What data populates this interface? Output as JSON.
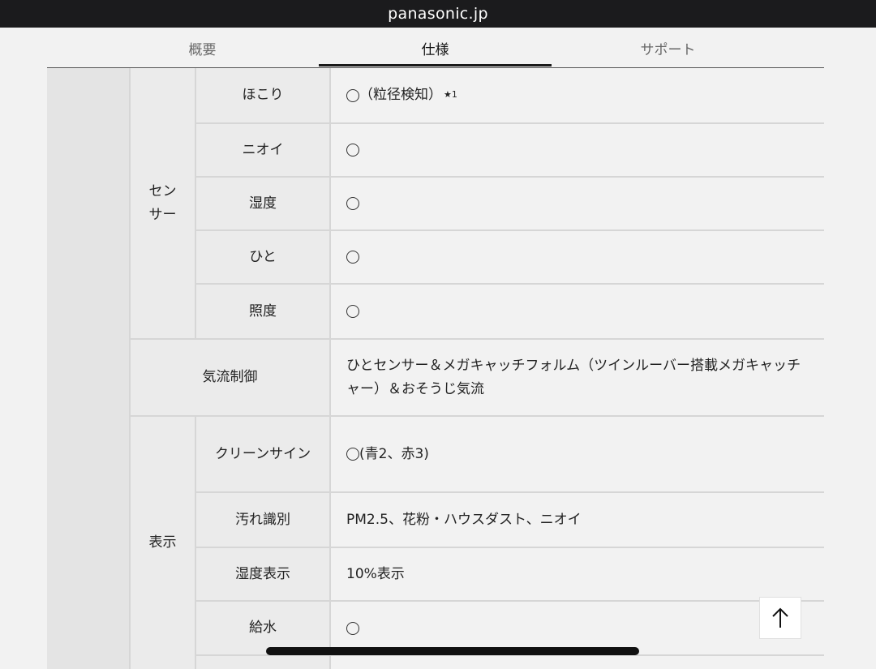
{
  "browser": {
    "url": "panasonic.jp"
  },
  "tabs": [
    {
      "label": "概要"
    },
    {
      "label": "仕様"
    },
    {
      "label": "サポート"
    }
  ],
  "spec": {
    "sensor": {
      "label": "センサー",
      "rows": [
        {
          "item": "ほこり",
          "value": "（粒径検知）",
          "note": "★1"
        },
        {
          "item": "ニオイ",
          "value": ""
        },
        {
          "item": "湿度",
          "value": ""
        },
        {
          "item": "ひと",
          "value": ""
        },
        {
          "item": "照度",
          "value": ""
        }
      ]
    },
    "airflow": {
      "label": "気流制御",
      "value": "ひとセンサー＆メガキャッチフォルム（ツインルーバー搭載メガキャッチャー）＆おそうじ気流"
    },
    "display": {
      "label": "表示",
      "rows": [
        {
          "item": "クリーンサイン",
          "value": "(青2、赤3)"
        },
        {
          "item": "汚れ識別",
          "value": "PM2.5、花粉・ハウスダスト、ニオイ"
        },
        {
          "item": "湿度表示",
          "value": "10%表示"
        },
        {
          "item": "給水",
          "value": ""
        }
      ]
    }
  },
  "icons": {
    "circle_mark": "circle-mark-icon",
    "back_to_top": "arrow-up-icon"
  }
}
